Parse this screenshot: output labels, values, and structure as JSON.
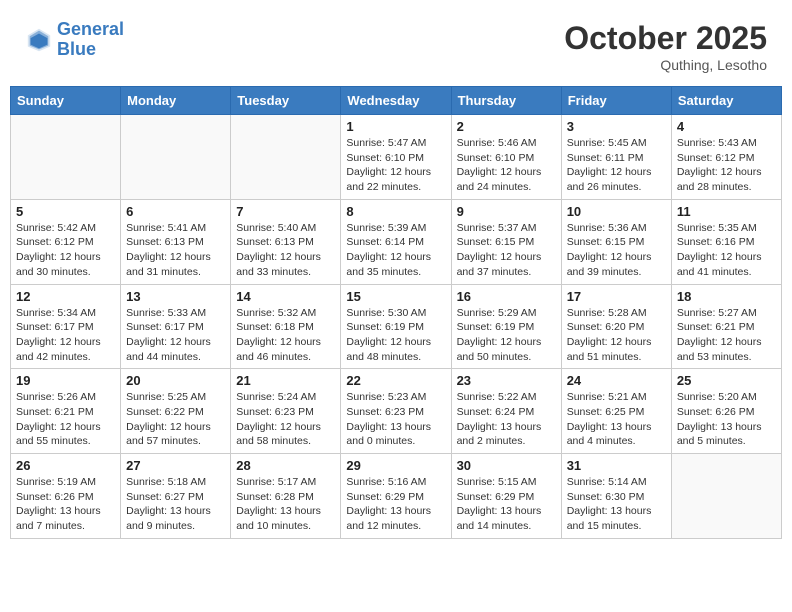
{
  "header": {
    "logo_line1": "General",
    "logo_line2": "Blue",
    "month": "October 2025",
    "location": "Quthing, Lesotho"
  },
  "weekdays": [
    "Sunday",
    "Monday",
    "Tuesday",
    "Wednesday",
    "Thursday",
    "Friday",
    "Saturday"
  ],
  "weeks": [
    [
      {
        "day": "",
        "info": ""
      },
      {
        "day": "",
        "info": ""
      },
      {
        "day": "",
        "info": ""
      },
      {
        "day": "1",
        "info": "Sunrise: 5:47 AM\nSunset: 6:10 PM\nDaylight: 12 hours\nand 22 minutes."
      },
      {
        "day": "2",
        "info": "Sunrise: 5:46 AM\nSunset: 6:10 PM\nDaylight: 12 hours\nand 24 minutes."
      },
      {
        "day": "3",
        "info": "Sunrise: 5:45 AM\nSunset: 6:11 PM\nDaylight: 12 hours\nand 26 minutes."
      },
      {
        "day": "4",
        "info": "Sunrise: 5:43 AM\nSunset: 6:12 PM\nDaylight: 12 hours\nand 28 minutes."
      }
    ],
    [
      {
        "day": "5",
        "info": "Sunrise: 5:42 AM\nSunset: 6:12 PM\nDaylight: 12 hours\nand 30 minutes."
      },
      {
        "day": "6",
        "info": "Sunrise: 5:41 AM\nSunset: 6:13 PM\nDaylight: 12 hours\nand 31 minutes."
      },
      {
        "day": "7",
        "info": "Sunrise: 5:40 AM\nSunset: 6:13 PM\nDaylight: 12 hours\nand 33 minutes."
      },
      {
        "day": "8",
        "info": "Sunrise: 5:39 AM\nSunset: 6:14 PM\nDaylight: 12 hours\nand 35 minutes."
      },
      {
        "day": "9",
        "info": "Sunrise: 5:37 AM\nSunset: 6:15 PM\nDaylight: 12 hours\nand 37 minutes."
      },
      {
        "day": "10",
        "info": "Sunrise: 5:36 AM\nSunset: 6:15 PM\nDaylight: 12 hours\nand 39 minutes."
      },
      {
        "day": "11",
        "info": "Sunrise: 5:35 AM\nSunset: 6:16 PM\nDaylight: 12 hours\nand 41 minutes."
      }
    ],
    [
      {
        "day": "12",
        "info": "Sunrise: 5:34 AM\nSunset: 6:17 PM\nDaylight: 12 hours\nand 42 minutes."
      },
      {
        "day": "13",
        "info": "Sunrise: 5:33 AM\nSunset: 6:17 PM\nDaylight: 12 hours\nand 44 minutes."
      },
      {
        "day": "14",
        "info": "Sunrise: 5:32 AM\nSunset: 6:18 PM\nDaylight: 12 hours\nand 46 minutes."
      },
      {
        "day": "15",
        "info": "Sunrise: 5:30 AM\nSunset: 6:19 PM\nDaylight: 12 hours\nand 48 minutes."
      },
      {
        "day": "16",
        "info": "Sunrise: 5:29 AM\nSunset: 6:19 PM\nDaylight: 12 hours\nand 50 minutes."
      },
      {
        "day": "17",
        "info": "Sunrise: 5:28 AM\nSunset: 6:20 PM\nDaylight: 12 hours\nand 51 minutes."
      },
      {
        "day": "18",
        "info": "Sunrise: 5:27 AM\nSunset: 6:21 PM\nDaylight: 12 hours\nand 53 minutes."
      }
    ],
    [
      {
        "day": "19",
        "info": "Sunrise: 5:26 AM\nSunset: 6:21 PM\nDaylight: 12 hours\nand 55 minutes."
      },
      {
        "day": "20",
        "info": "Sunrise: 5:25 AM\nSunset: 6:22 PM\nDaylight: 12 hours\nand 57 minutes."
      },
      {
        "day": "21",
        "info": "Sunrise: 5:24 AM\nSunset: 6:23 PM\nDaylight: 12 hours\nand 58 minutes."
      },
      {
        "day": "22",
        "info": "Sunrise: 5:23 AM\nSunset: 6:23 PM\nDaylight: 13 hours\nand 0 minutes."
      },
      {
        "day": "23",
        "info": "Sunrise: 5:22 AM\nSunset: 6:24 PM\nDaylight: 13 hours\nand 2 minutes."
      },
      {
        "day": "24",
        "info": "Sunrise: 5:21 AM\nSunset: 6:25 PM\nDaylight: 13 hours\nand 4 minutes."
      },
      {
        "day": "25",
        "info": "Sunrise: 5:20 AM\nSunset: 6:26 PM\nDaylight: 13 hours\nand 5 minutes."
      }
    ],
    [
      {
        "day": "26",
        "info": "Sunrise: 5:19 AM\nSunset: 6:26 PM\nDaylight: 13 hours\nand 7 minutes."
      },
      {
        "day": "27",
        "info": "Sunrise: 5:18 AM\nSunset: 6:27 PM\nDaylight: 13 hours\nand 9 minutes."
      },
      {
        "day": "28",
        "info": "Sunrise: 5:17 AM\nSunset: 6:28 PM\nDaylight: 13 hours\nand 10 minutes."
      },
      {
        "day": "29",
        "info": "Sunrise: 5:16 AM\nSunset: 6:29 PM\nDaylight: 13 hours\nand 12 minutes."
      },
      {
        "day": "30",
        "info": "Sunrise: 5:15 AM\nSunset: 6:29 PM\nDaylight: 13 hours\nand 14 minutes."
      },
      {
        "day": "31",
        "info": "Sunrise: 5:14 AM\nSunset: 6:30 PM\nDaylight: 13 hours\nand 15 minutes."
      },
      {
        "day": "",
        "info": ""
      }
    ]
  ]
}
